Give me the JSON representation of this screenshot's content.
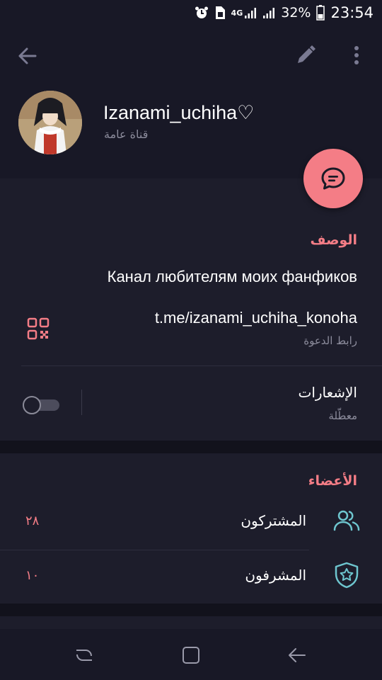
{
  "status_bar": {
    "network": "4G",
    "battery_percent": "32%",
    "time": "23:54"
  },
  "header": {
    "channel_name": "Izanami_uchiha♡",
    "channel_type": "قناة عامة"
  },
  "info": {
    "section_title": "الوصف",
    "description": "Канал любителям моих фанфиков",
    "invite_link": "t.me/izanami_uchiha_konoha",
    "invite_link_caption": "رابط الدعوة",
    "notifications_label": "الإشعارات",
    "notifications_status": "معطّلة",
    "notifications_enabled": false
  },
  "members": {
    "section_title": "الأعضاء",
    "rows": [
      {
        "label": "المشتركون",
        "count": "٢٨",
        "icon": "subscribers-icon"
      },
      {
        "label": "المشرفون",
        "count": "١٠",
        "icon": "admins-shield-star-icon"
      }
    ]
  },
  "colors": {
    "accent": "#f47d86",
    "teal_icon": "#6ec6cf",
    "background": "#12121c",
    "card": "#1d1d2b"
  }
}
